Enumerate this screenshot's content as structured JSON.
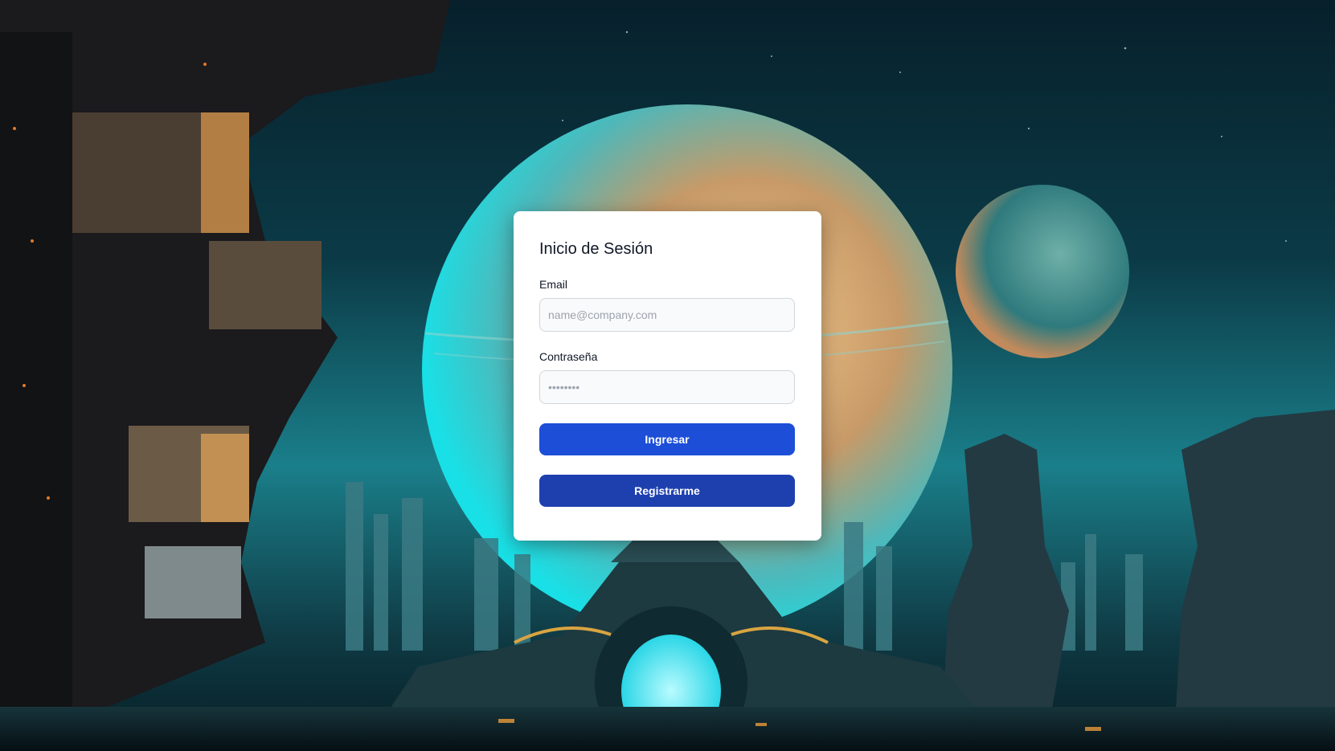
{
  "login": {
    "title": "Inicio de Sesión",
    "email_label": "Email",
    "email_placeholder": "name@company.com",
    "password_label": "Contraseña",
    "password_placeholder": "••••••••",
    "submit_label": "Ingresar",
    "register_label": "Registrarme"
  },
  "colors": {
    "primary_button": "#1d4ed8",
    "secondary_button": "#1e40af",
    "card_background": "#ffffff"
  }
}
